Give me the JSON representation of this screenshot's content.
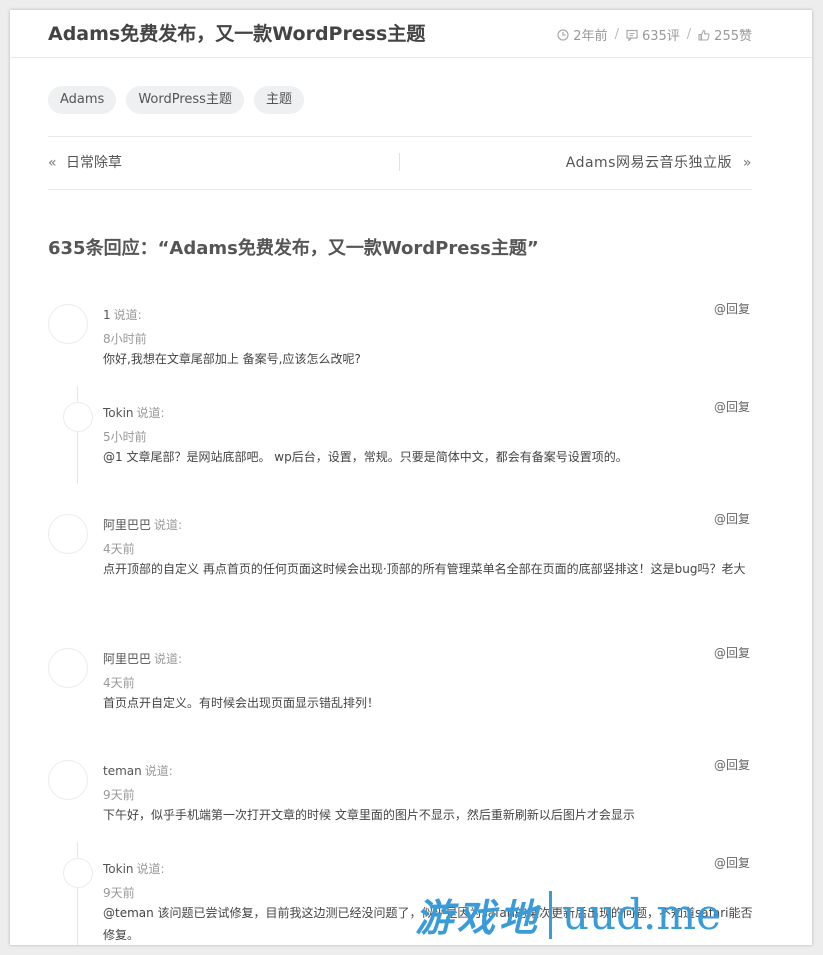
{
  "post": {
    "title": "Adams免费发布，又一款WordPress主题",
    "meta": {
      "time": "2年前",
      "comments": "635评",
      "likes": "255赞"
    }
  },
  "tags": [
    "Adams",
    "WordPress主题",
    "主题"
  ],
  "nav": {
    "prev_label": "日常除草",
    "next_label": "Adams网易云音乐独立版",
    "prev_arrow": "«",
    "next_arrow": "»"
  },
  "comments_title": "635条回应：“Adams免费发布，又一款WordPress主题”",
  "said_label": "说道:",
  "reply_label": "@回复",
  "comments": [
    {
      "author": "1",
      "time": "8小时前",
      "text": "你好,我想在文章尾部加上 备案号,应该怎么改呢?"
    },
    {
      "author": "Tokin",
      "time": "5小时前",
      "text": "@1 文章尾部？是网站底部吧。 wp后台，设置，常规。只要是简体中文，都会有备案号设置项的。"
    },
    {
      "author": "阿里巴巴",
      "time": "4天前",
      "text": "点开顶部的自定义 再点首页的任何页面这时候会出现·顶部的所有管理菜单名全部在页面的底部竖排这！这是bug吗？老大"
    },
    {
      "author": "阿里巴巴",
      "time": "4天前",
      "text": "首页点开自定义。有时候会出现页面显示错乱排列！"
    },
    {
      "author": "teman",
      "time": "9天前",
      "text": "下午好，似乎手机端第一次打开文章的时候 文章里面的图片不显示，然后重新刷新以后图片才会显示"
    },
    {
      "author": "Tokin",
      "time": "9天前",
      "text": "@teman 该问题已尝试修复，目前我这边测已经没问题了，似乎是因为safari的某次更新后出现的问题，不知道safari能否修复。"
    }
  ],
  "watermark": {
    "cn": "游戏地",
    "en": "uud.me"
  },
  "colors": {
    "watermark": "#3a9bd9",
    "title": "#444444",
    "muted": "#999999"
  }
}
